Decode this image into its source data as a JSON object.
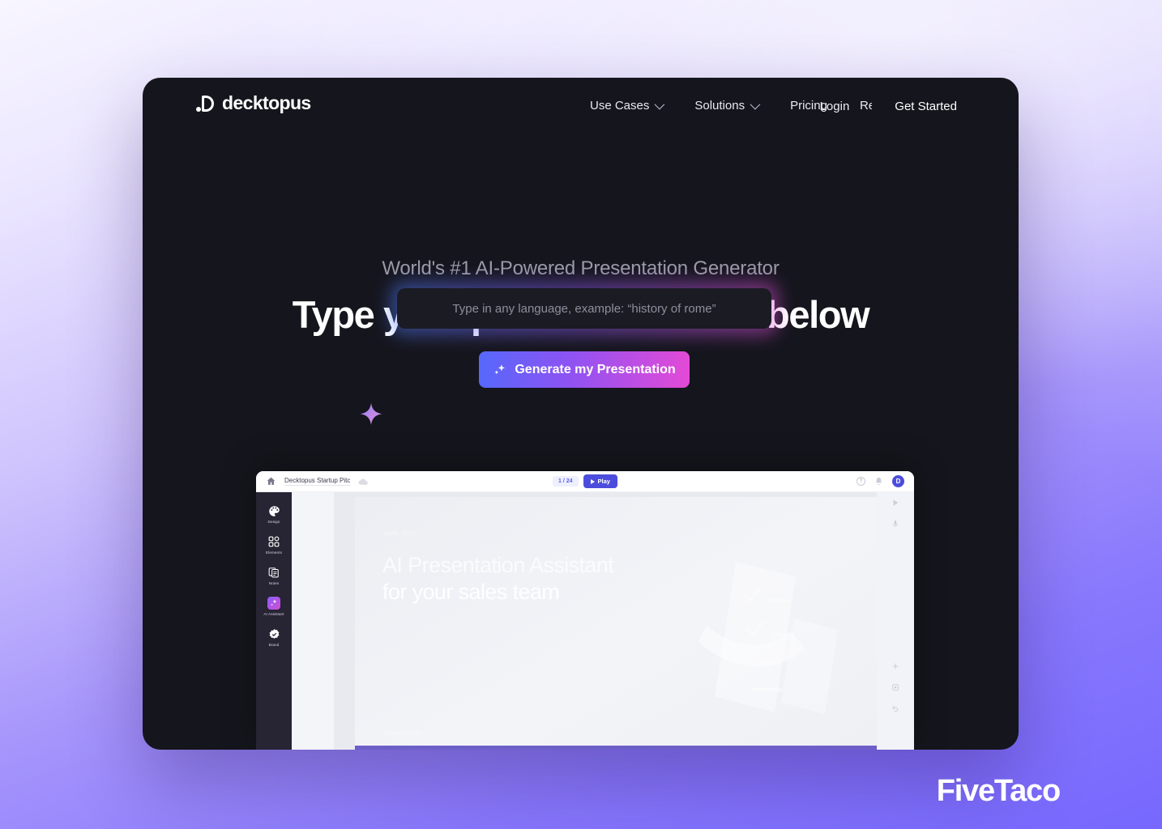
{
  "brand": {
    "name": "decktopus",
    "logo_icon": "decktopus-d-mark"
  },
  "nav": {
    "links": [
      {
        "label": "Use Cases",
        "has_caret": true
      },
      {
        "label": "Solutions",
        "has_caret": true
      },
      {
        "label": "Pricing",
        "has_caret": false
      },
      {
        "label": "Resources",
        "has_caret": true
      }
    ],
    "login_label": "Login",
    "get_started_label": "Get Started"
  },
  "hero": {
    "eyebrow": "World's #1 AI-Powered Presentation Generator",
    "headline": "Type your presentation title below",
    "input_value": "",
    "input_placeholder": "Type in any language, example: “history of rome”",
    "cta_label": "Generate my Presentation",
    "cta_icon": "sparkle-icon",
    "decor_icon": "four-point-star-icon"
  },
  "app_mock": {
    "toolbar": {
      "home_icon": "home-icon",
      "doc_title": "Decktopus Startup Pitc",
      "cloud_icon": "cloud-save-icon",
      "page_indicator": "1 / 24",
      "play_label": "Play",
      "play_icon": "play-icon",
      "help_icon": "help-icon",
      "help_glyph": "?",
      "bell_icon": "bell-icon",
      "avatar_initial": "D"
    },
    "sidebar": [
      {
        "label": "Design",
        "icon": "palette-icon",
        "active": false
      },
      {
        "label": "Elements",
        "icon": "grid-icon",
        "active": false
      },
      {
        "label": "Notes",
        "icon": "notes-icon",
        "active": false
      },
      {
        "label": "AI Assistant",
        "icon": "ai-sparkle-icon",
        "active": true
      },
      {
        "label": "Brand",
        "icon": "verified-badge-icon",
        "active": false
      }
    ],
    "slide": {
      "date": "April, 2023",
      "title_line1": "AI Presentation Assistant",
      "title_line2": "for your sales team",
      "footer": "Decktopus",
      "art_icon": "paper-checklist-illustration"
    }
  },
  "watermark": {
    "label": "FiveTaco"
  },
  "colors": {
    "card_bg": "#15151d",
    "accent_blue": "#5668fb",
    "accent_purple": "#8d53f3",
    "accent_pink": "#e44ad6",
    "page_bottom": "#7768fe",
    "app_sidebar": "#272433",
    "app_accent": "#4c4ddc"
  }
}
